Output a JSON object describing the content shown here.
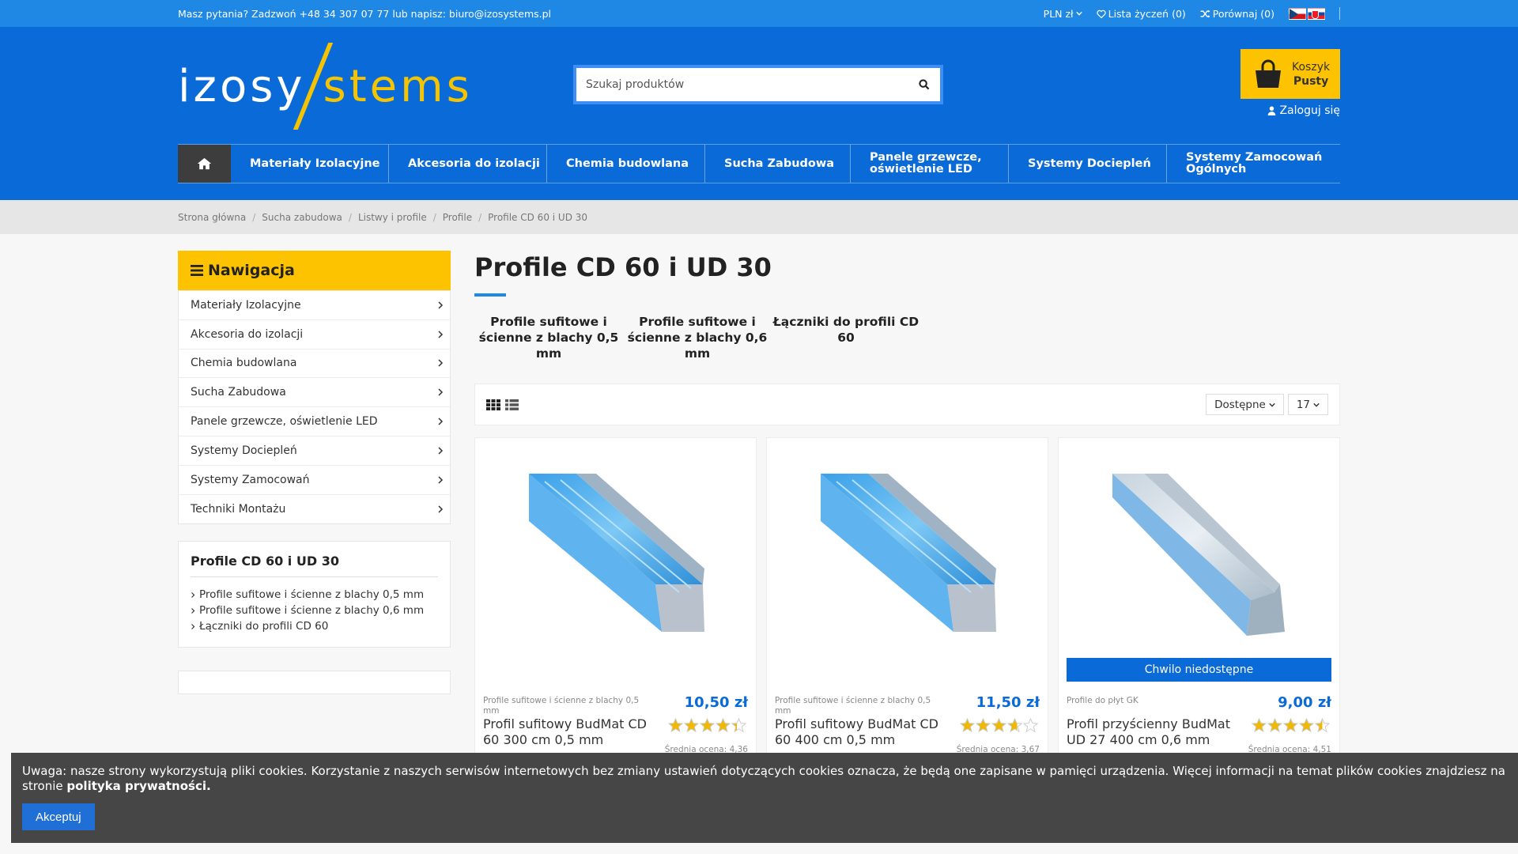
{
  "topbar": {
    "contact": "Masz pytania? Zadzwoń +48 34 307 07 77 lub napisz: biuro@izosystems.pl",
    "currency": "PLN zł",
    "wishlist": "Lista życzeń (0)",
    "compare": "Porównaj (0)"
  },
  "header": {
    "logo_part1": "izosy",
    "logo_part2": "stems",
    "search_placeholder": "Szukaj produktów",
    "cart_label": "Koszyk",
    "cart_status": "Pusty",
    "login": "Zaloguj się"
  },
  "nav": [
    "Materiały Izolacyjne",
    "Akcesoria do izolacji",
    "Chemia budowlana",
    "Sucha Zabudowa",
    "Panele grzewcze, oświetlenie LED",
    "Systemy Dociepleń",
    "Systemy Zamocowań Ogólnych"
  ],
  "breadcrumb": [
    "Strona główna",
    "Sucha zabudowa",
    "Listwy i profile",
    "Profile",
    "Profile CD 60 i UD 30"
  ],
  "sidebar": {
    "title": "Nawigacja",
    "categories": [
      "Materiały Izolacyjne",
      "Akcesoria do izolacji",
      "Chemia budowlana",
      "Sucha Zabudowa",
      "Panele grzewcze, oświetlenie LED",
      "Systemy Dociepleń",
      "Systemy Zamocowań",
      "Techniki Montażu"
    ],
    "subtitle": "Profile CD 60 i UD 30",
    "subitems": [
      "Profile sufitowe i ścienne z blachy 0,5 mm",
      "Profile sufitowe i ścienne z blachy 0,6 mm",
      "Łączniki do profili CD 60"
    ]
  },
  "content": {
    "title": "Profile CD 60 i UD 30",
    "subcategories": [
      "Profile sufitowe i ścienne z blachy 0,5 mm",
      "Profile sufitowe i ścienne z blachy 0,6 mm",
      "Łączniki do profili CD 60"
    ],
    "sort_label": "Dostępne",
    "per_page": "17"
  },
  "products": [
    {
      "category": "Profile sufitowe i ścienne z blachy 0,5 mm",
      "price": "10,50 zł",
      "name": "Profil sufitowy BudMat CD 60 300 cm 0,5 mm",
      "rating_text": "Średnia ocena: 4,36",
      "rating": 4.36,
      "unavailable": ""
    },
    {
      "category": "Profile sufitowe i ścienne z blachy 0,5 mm",
      "price": "11,50 zł",
      "name": "Profil sufitowy BudMat CD 60 400 cm 0,5 mm",
      "rating_text": "Średnia ocena: 3,67",
      "rating": 3.67,
      "unavailable": ""
    },
    {
      "category": "Profile do płyt GK",
      "price": "9,00 zł",
      "name": "Profil przyścienny BudMat UD 27 400 cm 0,6 mm",
      "rating_text": "Średnia ocena: 4,51",
      "rating": 4.51,
      "unavailable": "Chwilo niedostępne"
    }
  ],
  "cookie": {
    "text": "Uwaga: nasze strony wykorzystują pliki cookies. Korzystanie z naszych serwisów internetowych bez zmiany ustawień dotyczących cookies oznacza, że będą one zapisane w pamięci urządzenia. Więcej informacji na temat plików cookies znajdziesz na stronie ",
    "link": "polityka prywatności.",
    "accept": "Akceptuj"
  },
  "colors": {
    "primary": "#0a6ad8",
    "topbar": "#1f88e5",
    "accent": "#fdc300"
  }
}
